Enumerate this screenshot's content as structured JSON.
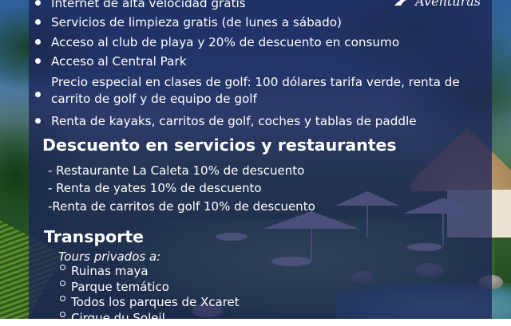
{
  "logo": {
    "text": "Aventuras",
    "icon": "palm-logo-icon"
  },
  "amenities": [
    "Internet de alta velocidad gratis",
    "Servicios de limpieza gratis (de lunes a sábado)",
    "Acceso al club de playa y 20% de descuento en consumo",
    "Acceso al Central Park",
    "Precio especial en clases de golf: 100 dólares tarifa verde, renta de carrito de golf y de equipo de golf",
    "Renta de kayaks, carritos de golf, coches y tablas de paddle"
  ],
  "discounts": {
    "title": "Descuento en servicios y restaurantes",
    "items": [
      "- Restaurante La Caleta 10% de descuento",
      "- Renta de yates 10% de descuento",
      "-Renta de carritos de golf 10% de descuento"
    ]
  },
  "transport": {
    "title": "Transporte",
    "tours_label": "Tours privados a:",
    "tours": [
      "Ruinas maya",
      "Parque temático",
      "Todos los parques de Xcaret",
      "Cirque du Soleil"
    ]
  }
}
